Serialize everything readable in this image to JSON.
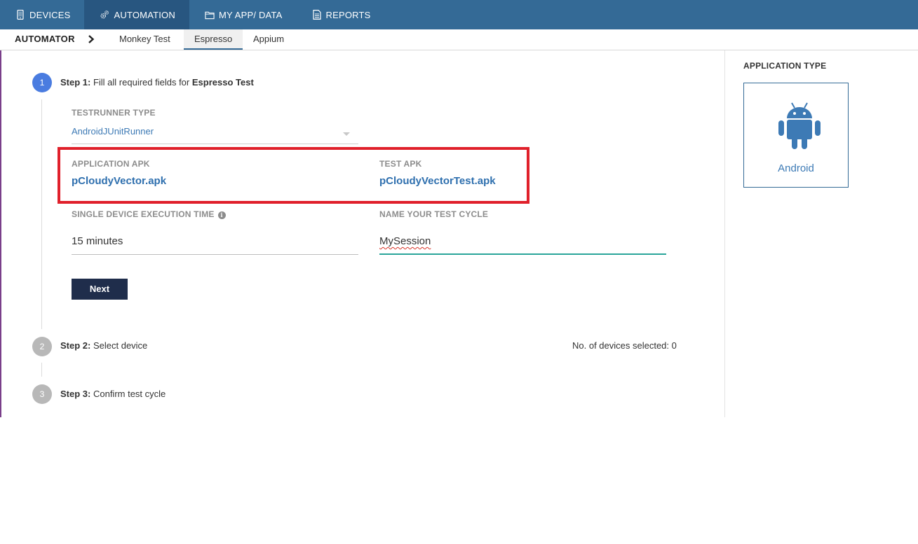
{
  "topnav": {
    "items": [
      {
        "label": "DEVICES",
        "icon": "phone-icon"
      },
      {
        "label": "AUTOMATION",
        "icon": "gears-icon",
        "active": true
      },
      {
        "label": "MY APP/ DATA",
        "icon": "folder-icon"
      },
      {
        "label": "REPORTS",
        "icon": "document-icon"
      }
    ]
  },
  "subnav": {
    "section": "AUTOMATOR",
    "tabs": [
      {
        "label": "Monkey Test"
      },
      {
        "label": "Espresso",
        "active": true
      },
      {
        "label": "Appium"
      }
    ]
  },
  "steps": [
    {
      "number": "1",
      "prefix": "Step 1:",
      "text": "Fill all required fields for",
      "emphasis": "Espresso Test",
      "status": "active"
    },
    {
      "number": "2",
      "prefix": "Step 2:",
      "text": "Select device",
      "status": "inactive"
    },
    {
      "number": "3",
      "prefix": "Step 3:",
      "text": "Confirm test cycle",
      "status": "inactive"
    }
  ],
  "form": {
    "testrunner_label": "TESTRUNNER TYPE",
    "testrunner_value": "AndroidJUnitRunner",
    "app_apk_label": "APPLICATION APK",
    "app_apk_value": "pCloudyVector.apk",
    "test_apk_label": "TEST APK",
    "test_apk_value": "pCloudyVectorTest.apk",
    "exec_time_label": "SINGLE DEVICE EXECUTION TIME",
    "exec_time_value": "15 minutes",
    "cycle_name_label": "NAME YOUR TEST CYCLE",
    "cycle_name_value": "MySession",
    "next_label": "Next"
  },
  "devices_selected": "No. of devices selected: 0",
  "right_panel": {
    "title": "APPLICATION TYPE",
    "app_type": "Android",
    "app_type_icon": "android-icon"
  },
  "colors": {
    "nav_bg": "#346a96",
    "nav_active": "#285680",
    "step_active": "#4a7ce0",
    "step_inactive": "#b8b8b8",
    "link": "#2e6fae",
    "highlight": "#e0202b",
    "button": "#1f2d4b",
    "focus_underline": "#2aa59a"
  }
}
